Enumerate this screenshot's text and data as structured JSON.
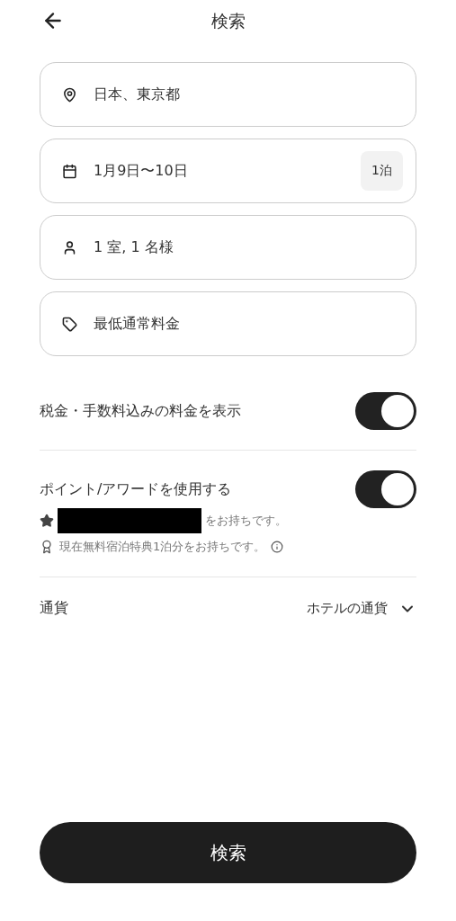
{
  "header": {
    "title": "検索"
  },
  "fields": [
    {
      "kind": "location",
      "value": "日本、東京都"
    },
    {
      "kind": "dates",
      "value": "1月9日〜10日",
      "badge": "1泊"
    },
    {
      "kind": "guests",
      "value": "1 室, 1 名様"
    },
    {
      "kind": "rate",
      "value": "最低通常料金"
    }
  ],
  "toggles": [
    {
      "label": "税金・手数料込みの料金を表示",
      "on": true
    },
    {
      "label": "ポイント/アワードを使用する",
      "on": true,
      "points_note": "をお持ちです。",
      "award_note": "現在無料宿泊特典1泊分をお持ちです。"
    }
  ],
  "currency": {
    "label": "通貨",
    "value": "ホテルの通貨"
  },
  "search_button": "検索"
}
